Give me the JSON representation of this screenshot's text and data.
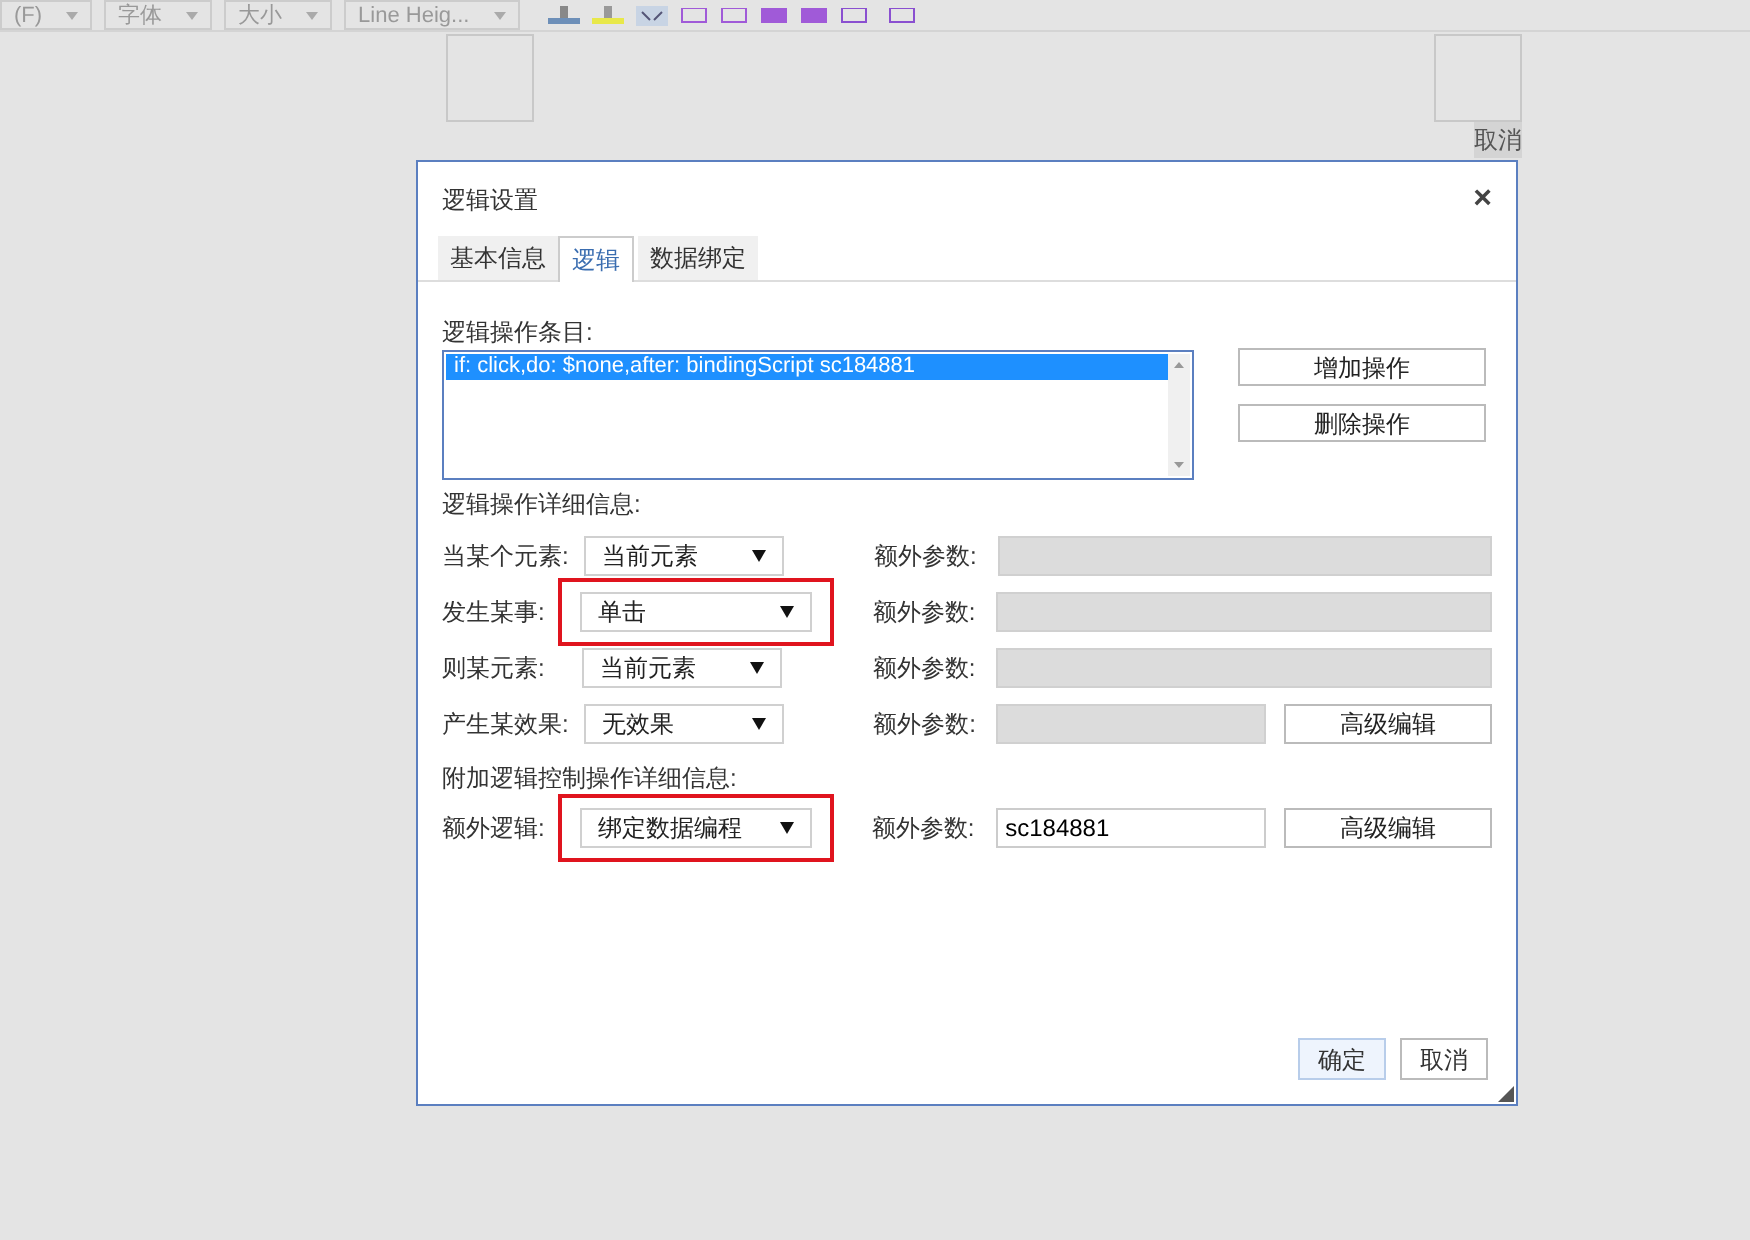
{
  "toolbar": {
    "dropdowns": [
      "(F)",
      "字体",
      "大小",
      "Line Heig..."
    ]
  },
  "image_caption": "取消",
  "dialog": {
    "title": "逻辑设置",
    "close": "×",
    "tabs": [
      {
        "label": "基本信息",
        "selected": false
      },
      {
        "label": "逻辑",
        "selected": true
      },
      {
        "label": "数据绑定",
        "selected": false
      }
    ],
    "entries_label": "逻辑操作条目:",
    "entries": [
      {
        "text": "if: click,do: $none,after: bindingScript sc184881",
        "selected": true
      }
    ],
    "entry_buttons": [
      "增加操作",
      "删除操作"
    ],
    "details_label": "逻辑操作详细信息:",
    "rows": [
      {
        "label": "当某个元素:",
        "value": "当前元素",
        "highlighted": false,
        "param_label": "额外参数:",
        "param": "",
        "param_disabled": true
      },
      {
        "label": "发生某事:",
        "value": "单击",
        "highlighted": true,
        "param_label": "额外参数:",
        "param": "",
        "param_disabled": true
      },
      {
        "label": "则某元素:",
        "value": "当前元素",
        "highlighted": false,
        "param_label": "额外参数:",
        "param": "",
        "param_disabled": true
      },
      {
        "label": "产生某效果:",
        "value": "无效果",
        "highlighted": false,
        "param_label": "额外参数:",
        "param": "",
        "param_disabled": true,
        "button": "高级编辑"
      }
    ],
    "extra_label": "附加逻辑控制操作详细信息:",
    "extra_rows": [
      {
        "label": "额外逻辑:",
        "value": "绑定数据编程",
        "highlighted": true,
        "param_label": "额外参数:",
        "param": "sc184881",
        "param_disabled": false,
        "button": "高级编辑"
      }
    ],
    "footer_buttons": [
      {
        "label": "确定",
        "primary": true
      },
      {
        "label": "取消",
        "primary": false
      }
    ]
  }
}
